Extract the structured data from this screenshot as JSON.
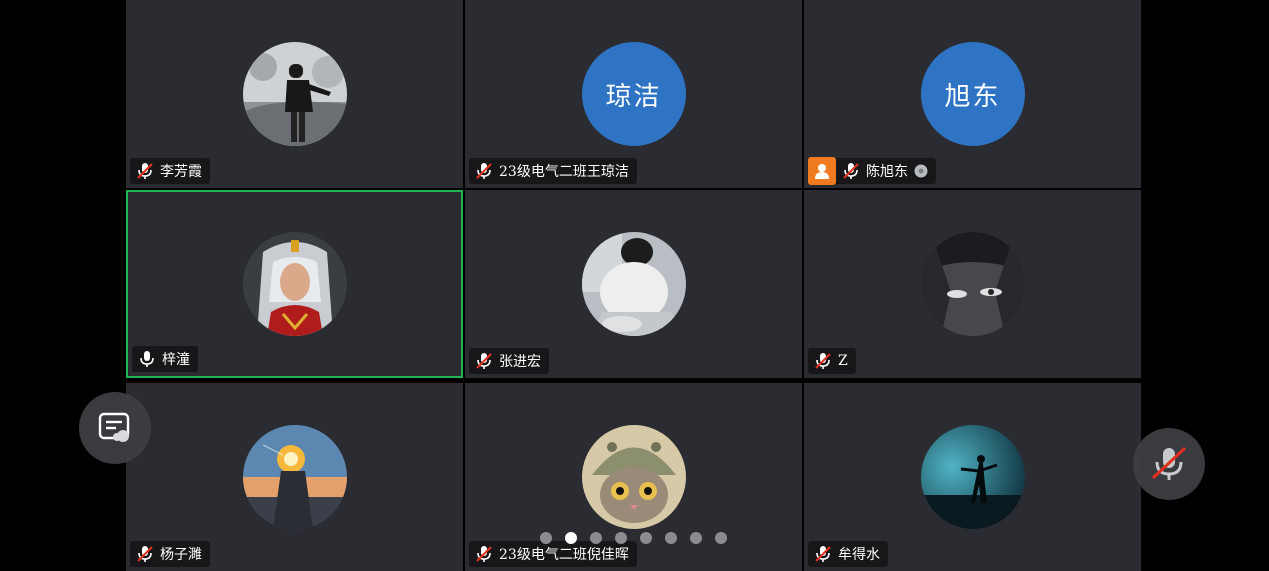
{
  "participants": [
    {
      "name": "李芳霞",
      "avatar_text": "",
      "avatar_icon": "photo-person-snow",
      "mic": "muted"
    },
    {
      "name": "23级电气二班王琼洁",
      "avatar_text": "琼洁",
      "avatar_icon": "",
      "mic": "muted"
    },
    {
      "name": "陈旭东",
      "avatar_text": "旭东",
      "avatar_icon": "",
      "mic": "muted",
      "host": true
    },
    {
      "name": "梓潼",
      "avatar_text": "",
      "avatar_icon": "photo-warrior",
      "mic": "on",
      "active_speaker": true
    },
    {
      "name": "张进宏",
      "avatar_text": "",
      "avatar_icon": "photo-person-sitting",
      "mic": "muted"
    },
    {
      "name": "Z",
      "avatar_text": "",
      "avatar_icon": "photo-anime-dark",
      "mic": "muted"
    },
    {
      "name": "杨子濉",
      "avatar_text": "",
      "avatar_icon": "photo-fire-head",
      "mic": "muted"
    },
    {
      "name": "23级电气二班倪佳晖",
      "avatar_text": "",
      "avatar_icon": "photo-cat",
      "mic": "muted"
    },
    {
      "name": "牟得水",
      "avatar_text": "",
      "avatar_icon": "photo-silhouette-sky",
      "mic": "muted"
    }
  ],
  "pagination": {
    "total_pages": 8,
    "current_page": 2
  },
  "colors": {
    "active_border": "#1fb552",
    "avatar_blue": "#2f74c4",
    "host_orange": "#f07a1f",
    "muted_red": "#e0301e"
  },
  "controls": {
    "left": "chat-list-icon",
    "right": "mic-muted-icon"
  }
}
